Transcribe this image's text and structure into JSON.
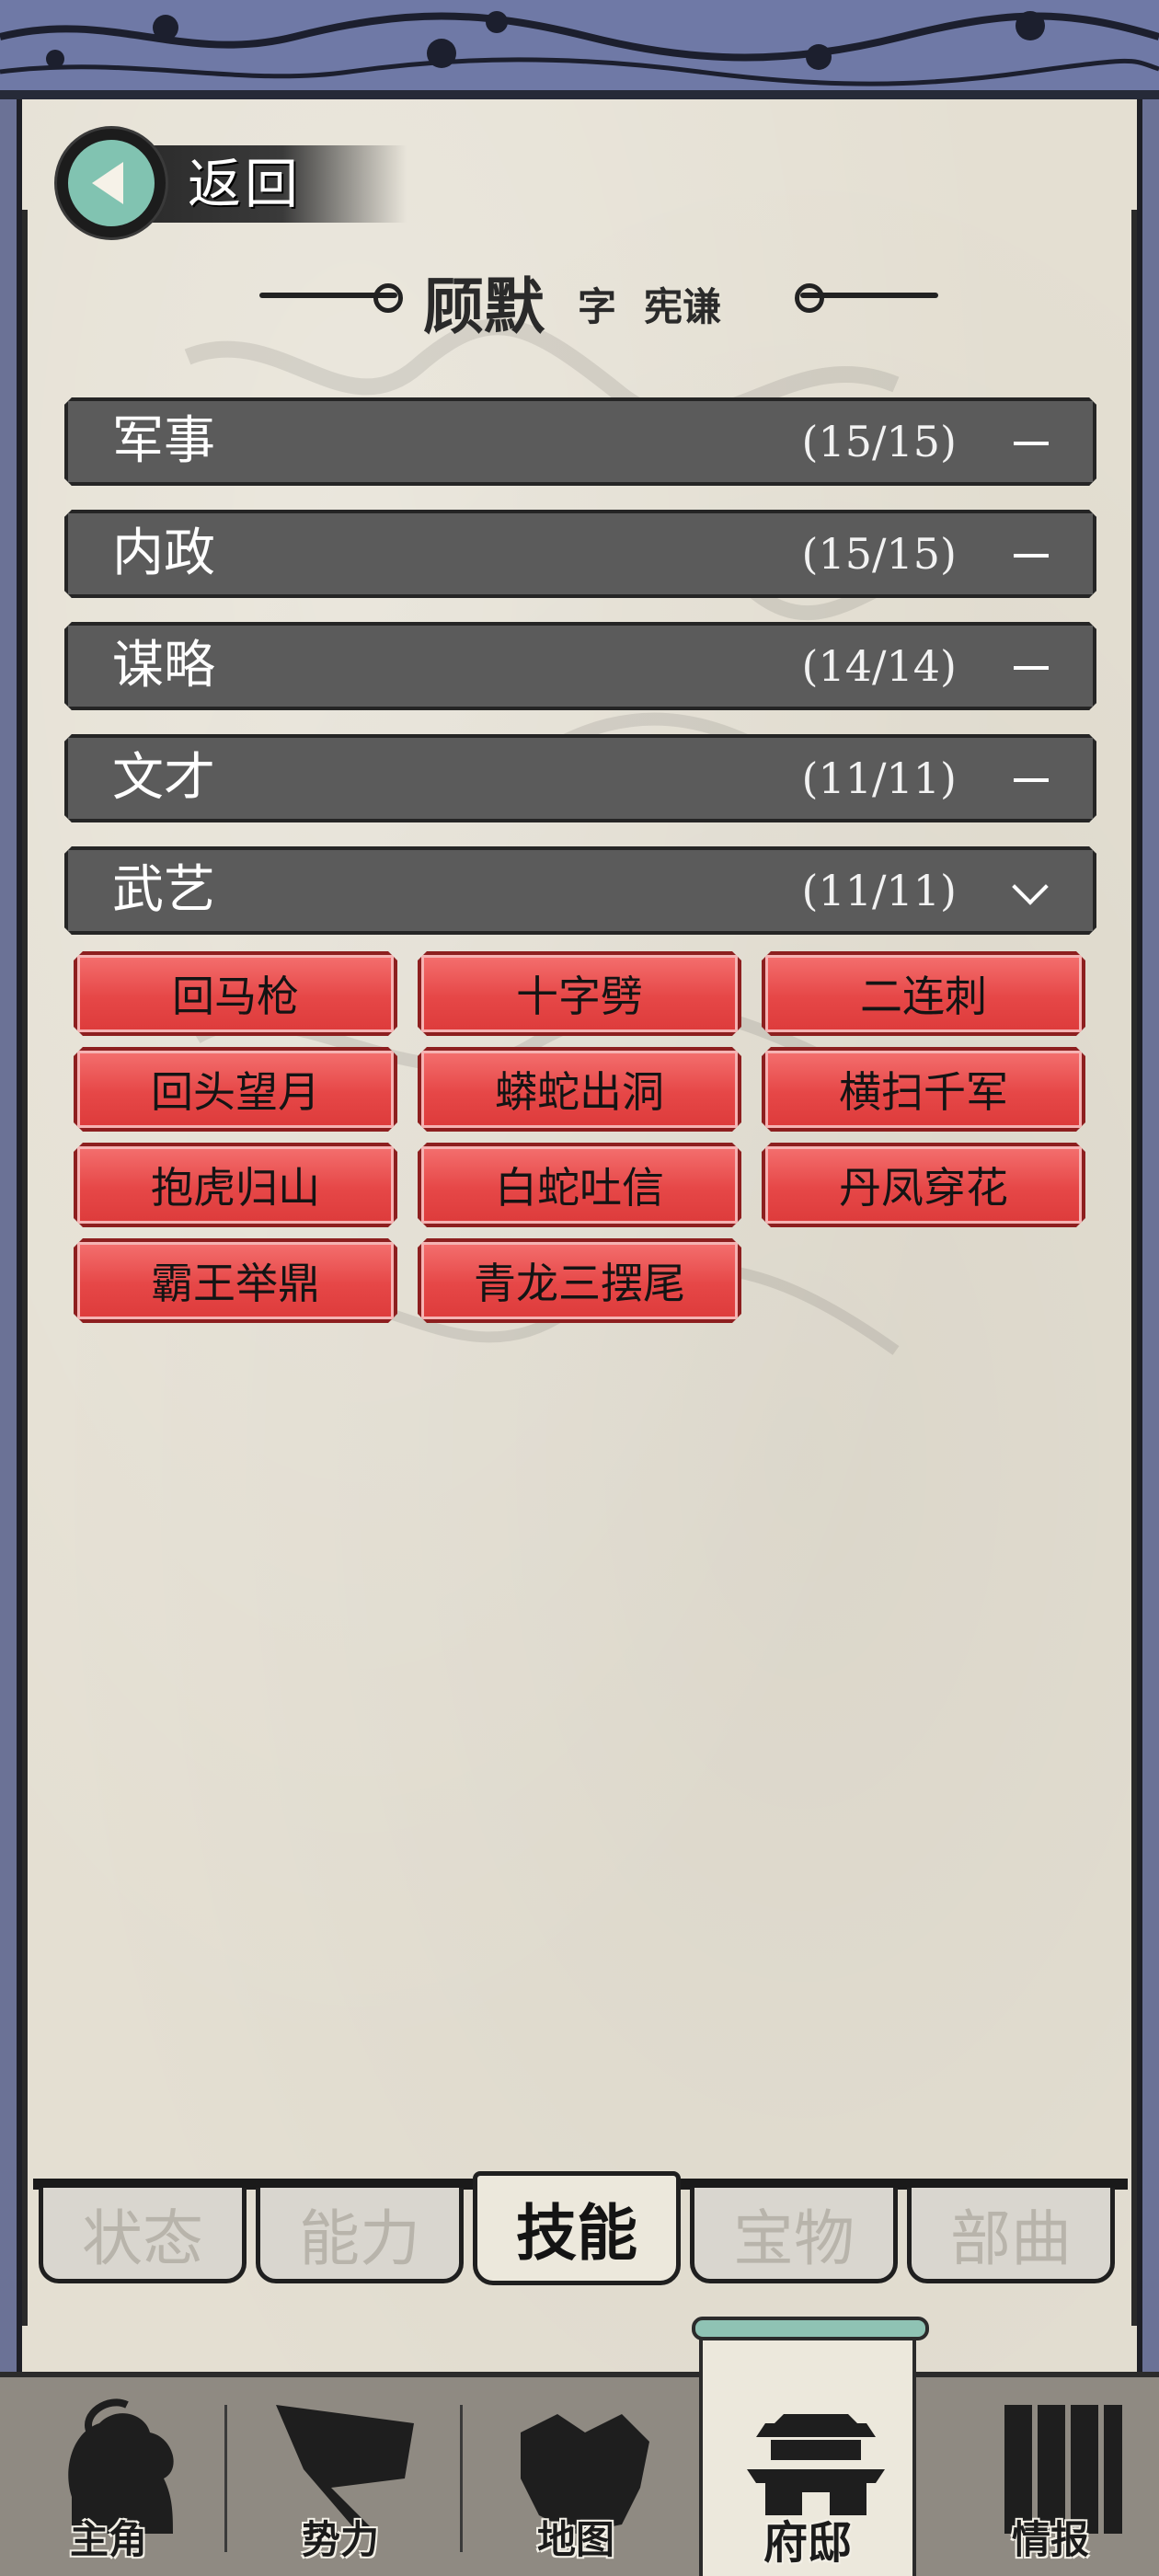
{
  "header": {
    "back_label": "返回",
    "person_name": "顾默",
    "zi_label": "字",
    "courtesy_name": "宪谦"
  },
  "categories": [
    {
      "name": "军事",
      "count": "(15/15)",
      "state": "collapsed"
    },
    {
      "name": "内政",
      "count": "(15/15)",
      "state": "collapsed"
    },
    {
      "name": "谋略",
      "count": "(14/14)",
      "state": "collapsed"
    },
    {
      "name": "文才",
      "count": "(11/11)",
      "state": "collapsed"
    },
    {
      "name": "武艺",
      "count": "(11/11)",
      "state": "expanded"
    }
  ],
  "skills": [
    "回马枪",
    "十字劈",
    "二连刺",
    "回头望月",
    "蟒蛇出洞",
    "横扫千军",
    "抱虎归山",
    "白蛇吐信",
    "丹凤穿花",
    "霸王举鼎",
    "青龙三摆尾"
  ],
  "tabs": [
    {
      "label": "状态",
      "active": false
    },
    {
      "label": "能力",
      "active": false
    },
    {
      "label": "技能",
      "active": true
    },
    {
      "label": "宝物",
      "active": false
    },
    {
      "label": "部曲",
      "active": false
    }
  ],
  "nav": [
    {
      "label": "主角",
      "icon": "warrior-icon",
      "active": false
    },
    {
      "label": "势力",
      "icon": "flag-icon",
      "active": false
    },
    {
      "label": "地图",
      "icon": "map-icon",
      "active": false
    },
    {
      "label": "府邸",
      "icon": "mansion-icon",
      "active": true
    },
    {
      "label": "情报",
      "icon": "scroll-icon",
      "active": false
    }
  ],
  "colors": {
    "border_blue": "#6f79a6",
    "bar_gray": "#5b5b5b",
    "skill_red": "#e64747",
    "back_teal": "#81c3b1",
    "paper": "#e4dfd2"
  }
}
